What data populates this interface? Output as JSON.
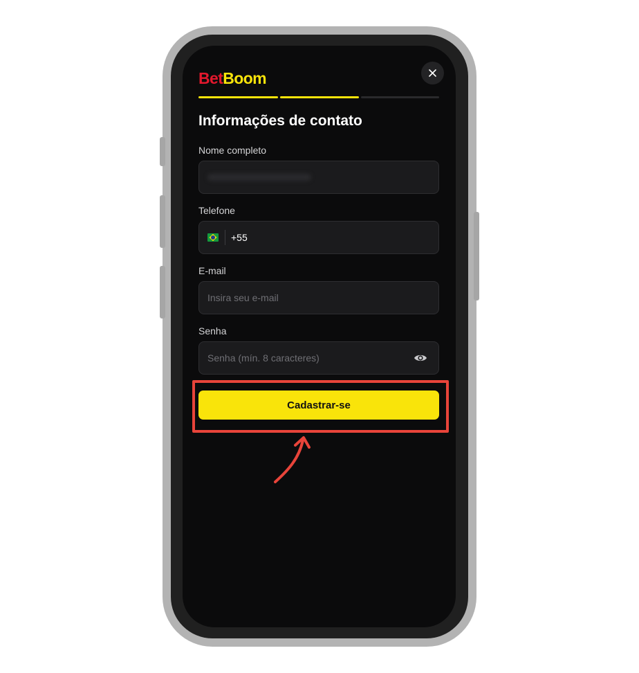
{
  "brand": {
    "part1": "Bet",
    "part2": "Boom",
    "color1": "#e3182d",
    "color2": "#f9e40a"
  },
  "progress": {
    "steps_total": 3,
    "steps_completed": 2,
    "active_color": "#f9e40a",
    "inactive_color": "#2a2a2c"
  },
  "form": {
    "title": "Informações de contato",
    "name": {
      "label": "Nome completo",
      "value": ""
    },
    "phone": {
      "label": "Telefone",
      "country_icon": "brazil-flag-icon",
      "code": "+55"
    },
    "email": {
      "label": "E-mail",
      "placeholder": "Insira seu e-mail"
    },
    "password": {
      "label": "Senha",
      "placeholder": "Senha (mín. 8 caracteres)",
      "toggle_icon": "eye-icon"
    },
    "submit_label": "Cadastrar-se"
  },
  "annotation": {
    "highlight_color": "#e8443a",
    "arrow_icon": "curved-arrow-up-icon"
  },
  "colors": {
    "screen_bg": "#0b0b0c",
    "field_bg": "#1b1b1d",
    "button_bg": "#f9e40a"
  }
}
